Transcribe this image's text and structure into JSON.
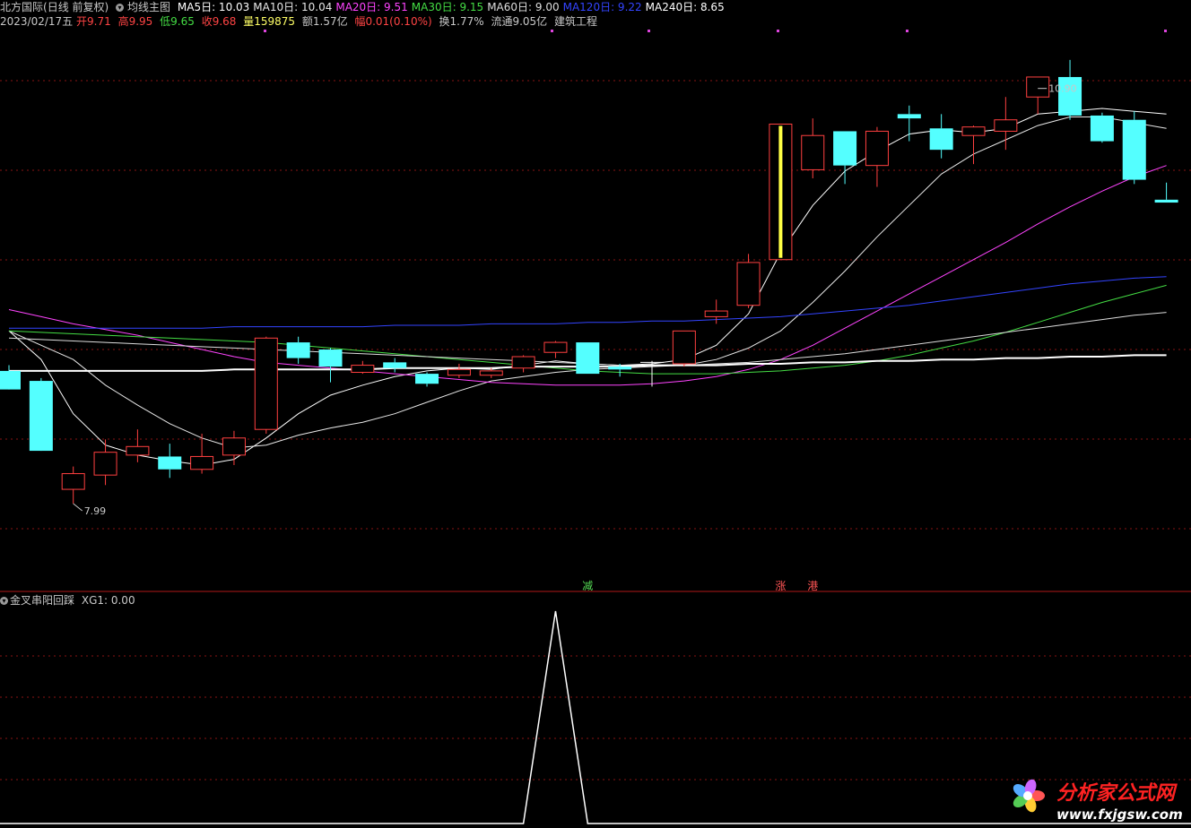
{
  "header": {
    "stock_name": "北方国际",
    "period": "(日线 前复权)",
    "indicator": "均线主图",
    "ma_values": [
      {
        "label": "MA5日",
        "value": "10.03",
        "color": "#ffffff"
      },
      {
        "label": "MA10日",
        "value": "10.04",
        "color": "#e8e8e8"
      },
      {
        "label": "MA20日",
        "value": "9.51",
        "color": "#ff44ff"
      },
      {
        "label": "MA30日",
        "value": "9.15",
        "color": "#44dd44"
      },
      {
        "label": "MA60日",
        "value": "9.00",
        "color": "#dddddd"
      },
      {
        "label": "MA120日",
        "value": "9.22",
        "color": "#3344ff"
      },
      {
        "label": "MA240日",
        "value": "8.65",
        "color": "#ffffff"
      }
    ],
    "date": "2023/02/17五",
    "open": "开9.71",
    "high": "高9.95",
    "low": "低9.65",
    "close": "收9.68",
    "volume": "量159875",
    "amount": "额1.57亿",
    "change": "幅0.01(0.10%)",
    "turnover": "换1.77%",
    "float_value": "流通9.05亿",
    "sector": "建筑工程"
  },
  "chart_data": [
    {
      "type": "candlestick",
      "title": "均线主图",
      "ylim": [
        7.5,
        11.3
      ],
      "annotations": [
        {
          "text": "10.90",
          "x": 32,
          "value": 10.9
        },
        {
          "text": "7.99",
          "x": 2,
          "value": 7.99
        }
      ],
      "signals": [
        {
          "text": "减",
          "x": 18,
          "color": "#55dd55"
        },
        {
          "text": "涨",
          "x": 24,
          "color": "#ff5555"
        },
        {
          "text": "港",
          "x": 25,
          "color": "#ff5555"
        }
      ],
      "candles": [
        [
          8.92,
          8.96,
          8.8,
          8.79
        ],
        [
          8.85,
          8.87,
          8.4,
          8.36
        ],
        [
          8.09,
          8.25,
          7.99,
          8.2
        ],
        [
          8.19,
          8.44,
          8.12,
          8.35
        ],
        [
          8.33,
          8.51,
          8.28,
          8.39
        ],
        [
          8.32,
          8.41,
          8.17,
          8.23
        ],
        [
          8.23,
          8.48,
          8.2,
          8.32
        ],
        [
          8.33,
          8.5,
          8.26,
          8.45
        ],
        [
          8.51,
          9.16,
          8.48,
          9.15
        ],
        [
          9.12,
          9.16,
          8.97,
          9.01
        ],
        [
          9.07,
          9.08,
          8.84,
          8.95
        ],
        [
          8.91,
          8.99,
          8.9,
          8.96
        ],
        [
          8.98,
          9.01,
          8.91,
          8.94
        ],
        [
          8.9,
          8.91,
          8.81,
          8.83
        ],
        [
          8.89,
          8.97,
          8.87,
          8.93
        ],
        [
          8.89,
          8.94,
          8.87,
          8.92
        ],
        [
          8.94,
          9.03,
          8.91,
          9.02
        ],
        [
          9.05,
          9.13,
          9.01,
          9.12
        ],
        [
          9.12,
          9.12,
          8.9,
          8.9
        ],
        [
          8.95,
          8.97,
          8.88,
          8.93
        ],
        [
          8.97,
          8.99,
          8.81,
          8.98
        ],
        [
          8.97,
          9.2,
          8.95,
          9.2
        ],
        [
          9.3,
          9.42,
          9.25,
          9.34
        ],
        [
          9.38,
          9.74,
          9.36,
          9.68
        ],
        [
          9.7,
          10.65,
          9.7,
          10.65
        ],
        [
          10.33,
          10.69,
          10.27,
          10.57
        ],
        [
          10.6,
          10.6,
          10.23,
          10.36
        ],
        [
          10.36,
          10.63,
          10.21,
          10.6
        ],
        [
          10.72,
          10.78,
          10.53,
          10.69
        ],
        [
          10.62,
          10.72,
          10.41,
          10.47
        ],
        [
          10.57,
          10.64,
          10.37,
          10.63
        ],
        [
          10.6,
          10.84,
          10.47,
          10.68
        ],
        [
          10.84,
          10.9,
          10.72,
          10.98
        ],
        [
          10.98,
          11.1,
          10.68,
          10.71
        ],
        [
          10.71,
          10.73,
          10.52,
          10.53
        ],
        [
          10.68,
          10.74,
          10.23,
          10.26
        ],
        [
          10.12,
          10.24,
          10.1,
          10.1
        ]
      ],
      "series": [
        {
          "name": "MA5日",
          "color": "#ffffff",
          "values": [
            9.2,
            9.0,
            8.62,
            8.4,
            8.33,
            8.29,
            8.26,
            8.3,
            8.45,
            8.62,
            8.75,
            8.82,
            8.88,
            8.92,
            8.94,
            8.93,
            8.96,
            8.99,
            8.97,
            8.96,
            8.97,
            9.0,
            9.1,
            9.32,
            9.75,
            10.08,
            10.32,
            10.46,
            10.58,
            10.61,
            10.59,
            10.62,
            10.72,
            10.74,
            10.76,
            10.74,
            10.72
          ]
        },
        {
          "name": "MA10日",
          "color": "#e8e8e8",
          "values": [
            9.2,
            9.1,
            9.0,
            8.82,
            8.68,
            8.55,
            8.45,
            8.38,
            8.4,
            8.47,
            8.52,
            8.56,
            8.62,
            8.7,
            8.78,
            8.85,
            8.88,
            8.91,
            8.93,
            8.94,
            8.95,
            8.96,
            9.0,
            9.08,
            9.2,
            9.4,
            9.62,
            9.86,
            10.08,
            10.3,
            10.44,
            10.54,
            10.64,
            10.7,
            10.7,
            10.66,
            10.62
          ]
        },
        {
          "name": "MA20日",
          "color": "#ff44ff",
          "values": [
            9.35,
            9.3,
            9.25,
            9.21,
            9.17,
            9.12,
            9.07,
            9.02,
            8.98,
            8.96,
            8.94,
            8.92,
            8.9,
            8.88,
            8.86,
            8.84,
            8.83,
            8.82,
            8.82,
            8.82,
            8.83,
            8.85,
            8.88,
            8.93,
            9.0,
            9.1,
            9.22,
            9.34,
            9.46,
            9.58,
            9.7,
            9.82,
            9.95,
            10.07,
            10.18,
            10.28,
            10.36
          ]
        },
        {
          "name": "MA30日",
          "color": "#44dd44",
          "values": [
            9.2,
            9.19,
            9.18,
            9.17,
            9.16,
            9.15,
            9.14,
            9.13,
            9.12,
            9.1,
            9.08,
            9.06,
            9.04,
            9.02,
            9.0,
            8.98,
            8.96,
            8.94,
            8.92,
            8.91,
            8.9,
            8.9,
            8.9,
            8.91,
            8.92,
            8.94,
            8.96,
            8.99,
            9.03,
            9.08,
            9.13,
            9.19,
            9.26,
            9.33,
            9.4,
            9.46,
            9.52
          ]
        },
        {
          "name": "MA60日",
          "color": "#dddddd",
          "values": [
            9.15,
            9.14,
            9.13,
            9.12,
            9.11,
            9.1,
            9.09,
            9.08,
            9.07,
            9.06,
            9.05,
            9.04,
            9.03,
            9.02,
            9.01,
            9.0,
            8.99,
            8.98,
            8.97,
            8.96,
            8.96,
            8.96,
            8.97,
            8.98,
            9.0,
            9.02,
            9.04,
            9.07,
            9.1,
            9.13,
            9.16,
            9.19,
            9.22,
            9.25,
            9.28,
            9.31,
            9.33
          ]
        },
        {
          "name": "MA120日",
          "color": "#3344ff",
          "values": [
            9.22,
            9.22,
            9.22,
            9.22,
            9.22,
            9.22,
            9.22,
            9.23,
            9.23,
            9.23,
            9.23,
            9.23,
            9.24,
            9.24,
            9.24,
            9.25,
            9.25,
            9.25,
            9.26,
            9.26,
            9.27,
            9.27,
            9.28,
            9.29,
            9.3,
            9.32,
            9.34,
            9.36,
            9.38,
            9.41,
            9.44,
            9.47,
            9.5,
            9.53,
            9.55,
            9.57,
            9.58
          ]
        },
        {
          "name": "MA240日",
          "color": "#ffffff",
          "values": [
            8.92,
            8.92,
            8.92,
            8.92,
            8.92,
            8.92,
            8.92,
            8.93,
            8.93,
            8.93,
            8.93,
            8.93,
            8.94,
            8.94,
            8.94,
            8.94,
            8.95,
            8.95,
            8.95,
            8.95,
            8.96,
            8.96,
            8.96,
            8.97,
            8.97,
            8.98,
            8.98,
            8.99,
            8.99,
            9.0,
            9.0,
            9.01,
            9.01,
            9.02,
            9.02,
            9.03,
            9.03
          ]
        }
      ]
    },
    {
      "type": "line",
      "title": "金叉串阳回踩",
      "series_label": "XG1: 0.00",
      "ylim": [
        0,
        1
      ],
      "series": [
        {
          "color": "#ffffff",
          "values": [
            0,
            0,
            0,
            0,
            0,
            0,
            0,
            0,
            0,
            0,
            0,
            0,
            0,
            0,
            0,
            0,
            0,
            1,
            0,
            0,
            0,
            0,
            0,
            0,
            0,
            0,
            0,
            0,
            0,
            0,
            0,
            0,
            0,
            0,
            0,
            0,
            0
          ]
        }
      ]
    }
  ],
  "watermark": {
    "name": "分析家公式网",
    "url": "www.fxjgsw.com"
  }
}
